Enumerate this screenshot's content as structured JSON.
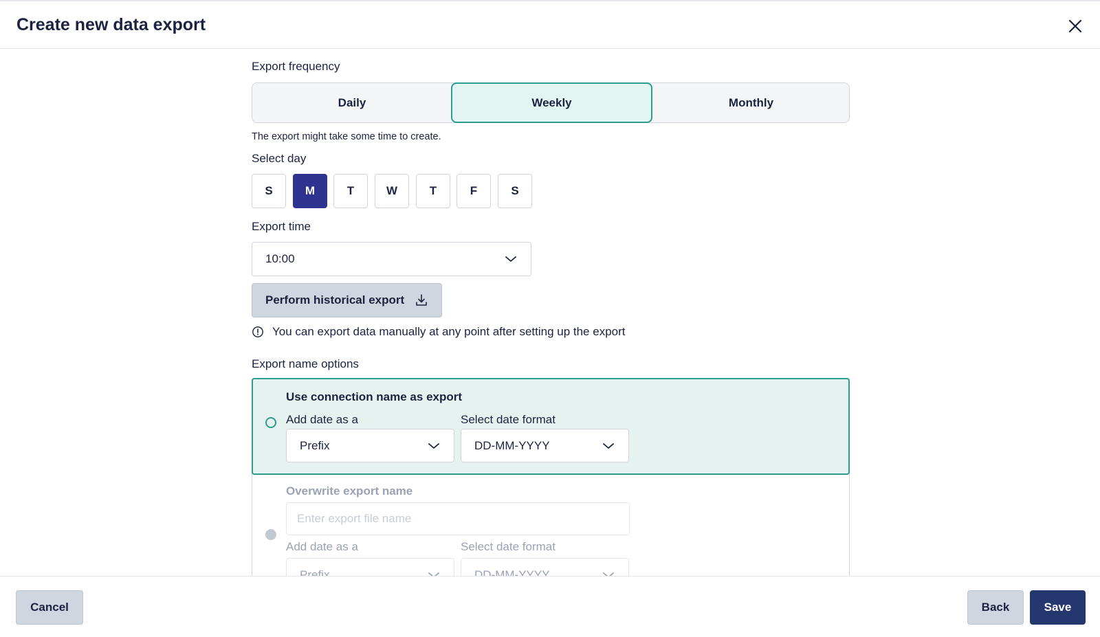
{
  "dialog": {
    "title": "Create new data export"
  },
  "frequency": {
    "label": "Export frequency",
    "options": [
      "Daily",
      "Weekly",
      "Monthly"
    ],
    "selected": "Weekly",
    "hint": "The export might take some time to create."
  },
  "day": {
    "label": "Select day",
    "options": [
      "S",
      "M",
      "T",
      "W",
      "T",
      "F",
      "S"
    ],
    "selected_index": 1
  },
  "time": {
    "label": "Export time",
    "value": "10:00"
  },
  "historical": {
    "button_label": "Perform historical export",
    "info": "You can export data manually at any point after setting up the export"
  },
  "name_options": {
    "label": "Export name options",
    "connection": {
      "title": "Use connection name as export",
      "date_position_label": "Add date as a",
      "date_position_value": "Prefix",
      "date_format_label": "Select date format",
      "date_format_value": "DD-MM-YYYY"
    },
    "overwrite": {
      "title": "Overwrite export name",
      "input_placeholder": "Enter export file name",
      "date_position_label": "Add date as a",
      "date_position_value": "Prefix",
      "date_format_label": "Select date format",
      "date_format_value": "DD-MM-YYYY"
    }
  },
  "footer": {
    "cancel_label": "Cancel",
    "back_label": "Back",
    "save_label": "Save"
  },
  "colors": {
    "accent": "#2a9d8f",
    "selected_day": "#2d338f",
    "primary_button": "#24386f"
  }
}
